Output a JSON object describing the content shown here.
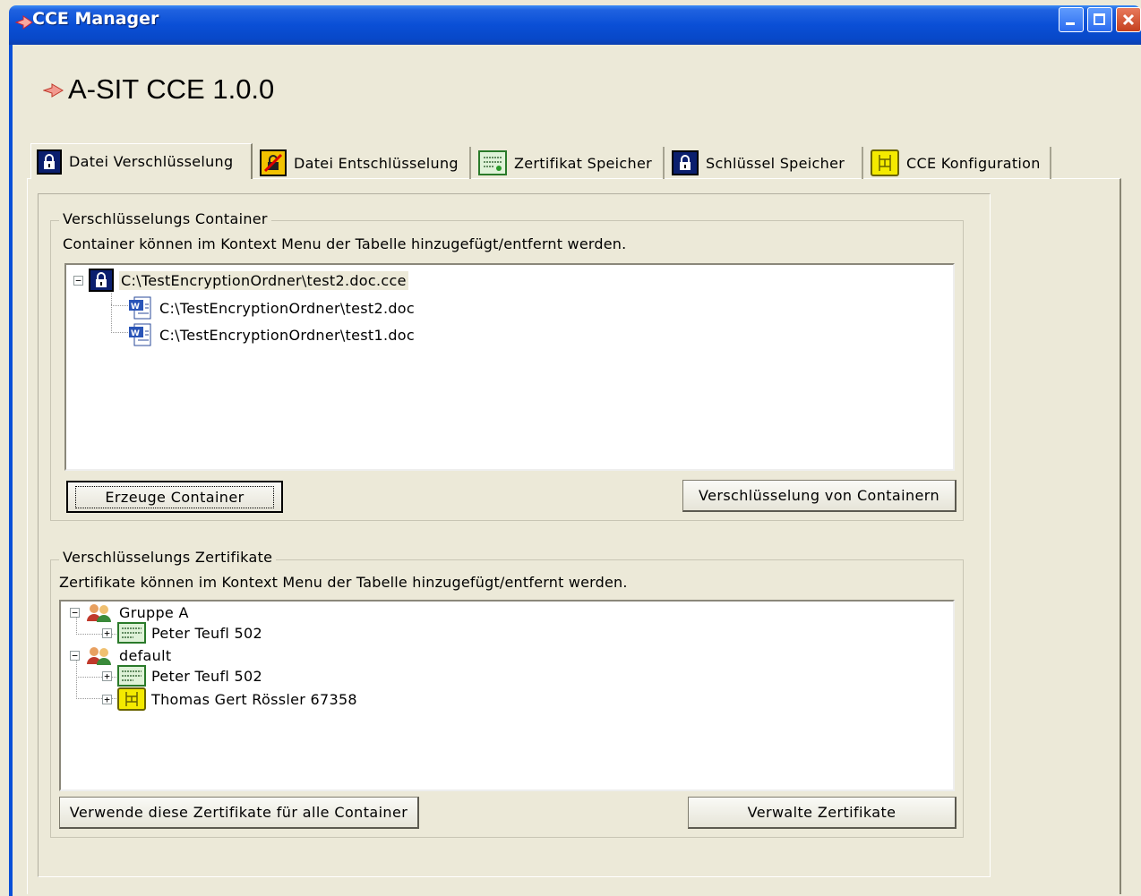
{
  "window": {
    "title": "CCE Manager",
    "title_icon": "cce-logo-icon",
    "controls": [
      "minimize-icon",
      "maximize-icon",
      "close-icon"
    ]
  },
  "app_title": "A-SIT CCE 1.0.0",
  "tabs": [
    {
      "label": "Datei Verschlüsselung",
      "icon": "lock-icon",
      "active": true
    },
    {
      "label": "Datei Entschlüsselung",
      "icon": "unlock-icon",
      "active": false
    },
    {
      "label": "Zertifikat Speicher",
      "icon": "certificate-icon",
      "active": false
    },
    {
      "label": "Schlüssel Speicher",
      "icon": "key-lock-icon",
      "active": false
    },
    {
      "label": "CCE Konfiguration",
      "icon": "chip-card-icon",
      "active": false
    }
  ],
  "containers": {
    "legend": "Verschlüsselungs Container",
    "hint": "Container können im Kontext Menu der Tabelle hinzugefügt/entfernt werden.",
    "tree": {
      "root": "C:\\TestEncryptionOrdner\\test2.doc.cce",
      "children": [
        "C:\\TestEncryptionOrdner\\test2.doc",
        "C:\\TestEncryptionOrdner\\test1.doc"
      ]
    },
    "create_button": "Erzeuge Container",
    "encrypt_button": "Verschlüsselung von Containern"
  },
  "certificates": {
    "legend": "Verschlüsselungs Zertifikate",
    "hint": "Zertifikate können im Kontext Menu der Tabelle hinzugefügt/entfernt werden.",
    "groups": [
      {
        "name": "Gruppe A",
        "items": [
          "Peter Teufl 502"
        ]
      },
      {
        "name": "default",
        "items": [
          "Peter Teufl 502",
          "Thomas Gert Rössler 67358"
        ]
      }
    ],
    "use_all_button": "Verwende diese Zertifikate für alle Container",
    "manage_button": "Verwalte Zertifikate"
  },
  "colors": {
    "titlebar": "#0a4fd6",
    "window_bg": "#ece9d8",
    "tree_bg": "#ffffff",
    "selection": "#ece9d8"
  }
}
